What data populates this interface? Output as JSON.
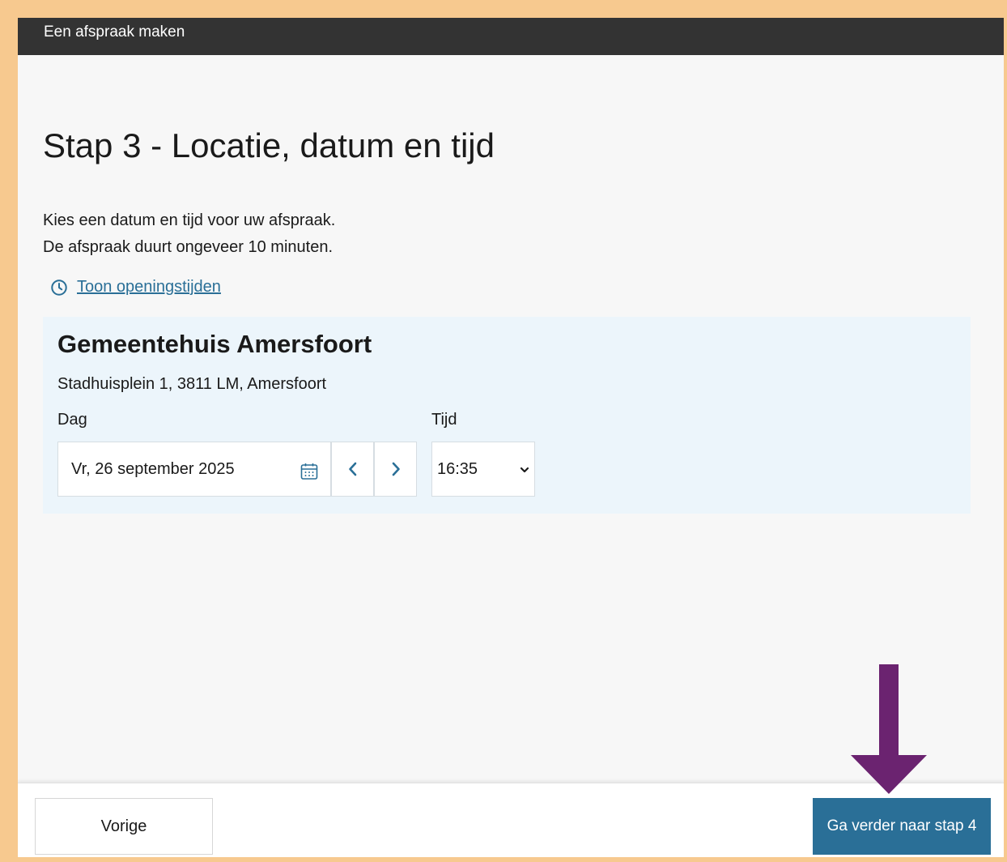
{
  "header": {
    "title": "Een afspraak maken"
  },
  "main": {
    "title": "Stap 3 - Locatie, datum en tijd",
    "intro_line1": "Kies een datum en tijd voor uw afspraak.",
    "intro_line2": "De afspraak duurt ongeveer 10 minuten.",
    "hours_link": "Toon openingstijden"
  },
  "location": {
    "name": "Gemeentehuis Amersfoort",
    "address": "Stadhuisplein 1, 3811 LM, Amersfoort",
    "day_label": "Dag",
    "time_label": "Tijd",
    "selected_date": "Vr, 26 september 2025",
    "selected_time": "16:35"
  },
  "footer": {
    "prev_label": "Vorige",
    "next_label": "Ga verder naar stap 4"
  },
  "colors": {
    "frame_border": "#f7c98f",
    "topbar": "#333333",
    "accent": "#2a6f97",
    "card_background": "#ecf5fb",
    "arrow": "#6b2370"
  },
  "icons": {
    "hours_link": "clock-icon",
    "date_field": "calendar-icon",
    "prev_day": "chevron-left-icon",
    "next_day": "chevron-right-icon",
    "time_select": "chevron-down-icon",
    "annotation": "arrow-down-icon"
  }
}
